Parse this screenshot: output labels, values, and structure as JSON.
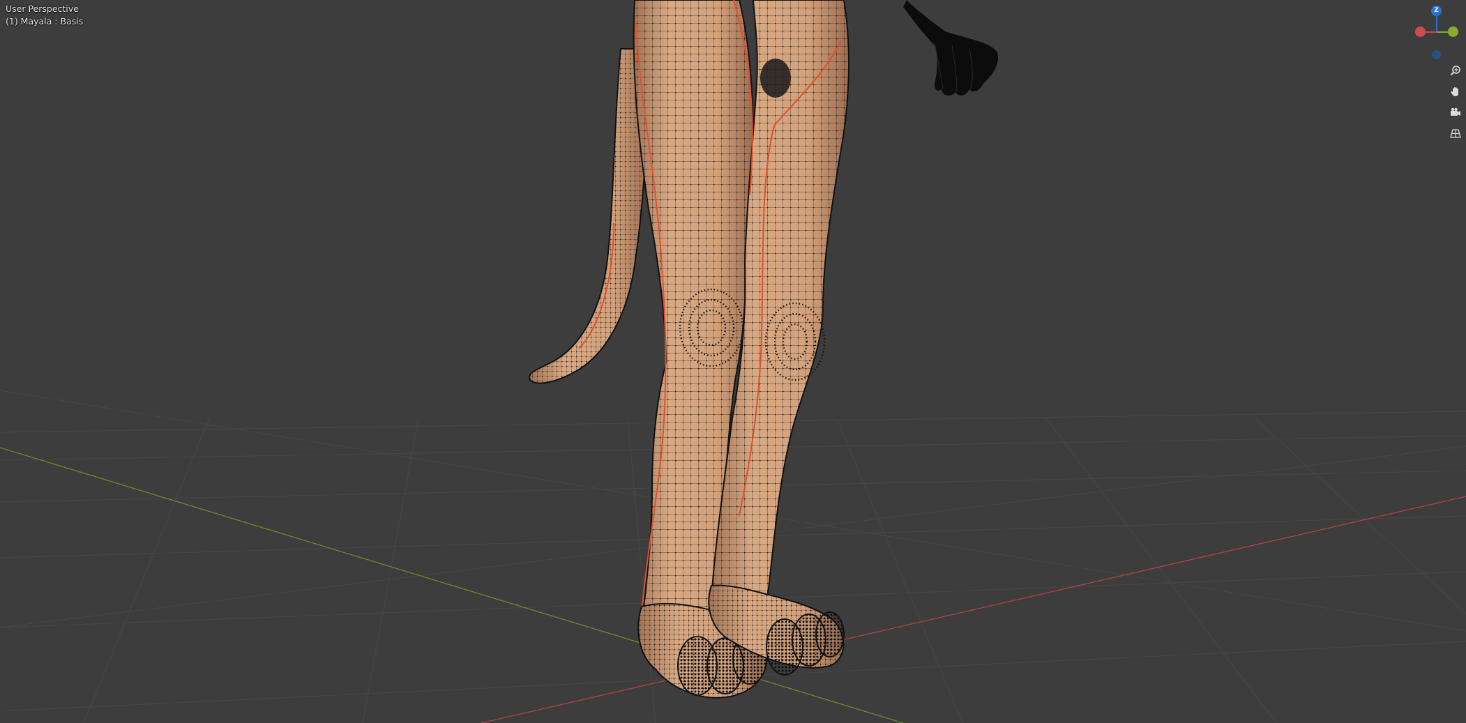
{
  "viewport": {
    "view_name": "User Perspective",
    "object_info": "(1) Mayala : Basis"
  },
  "colors": {
    "background": "#3d3d3d",
    "grid_line": "#4a4a4a",
    "x_axis": "#b0404a",
    "y_axis": "#6e8a2c",
    "skin": "#d6a27c",
    "wire": "#141414",
    "seam": "#e05030"
  },
  "gizmo": {
    "z_label": "Z",
    "z_color": "#2a73d6",
    "x_color": "#d04a52",
    "y_color": "#8aab2c",
    "neg_x_color": "#7a3540",
    "neg_y_color": "#4d5f25",
    "neg_z_color": "#2a4f8a"
  },
  "nav_buttons": [
    {
      "name": "zoom-icon"
    },
    {
      "name": "hand-pan-icon"
    },
    {
      "name": "camera-view-icon"
    },
    {
      "name": "perspective-grid-icon"
    }
  ]
}
